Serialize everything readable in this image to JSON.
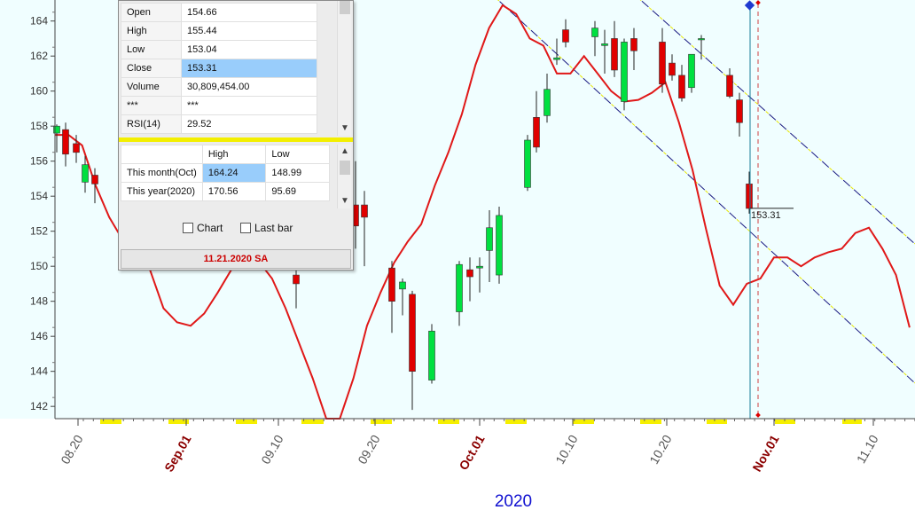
{
  "chart_data": {
    "type": "candlestick",
    "symbol_panel": {
      "ohlc_rows": [
        {
          "label": "Open",
          "value": "154.66"
        },
        {
          "label": "High",
          "value": "155.44"
        },
        {
          "label": "Low",
          "value": "153.04"
        },
        {
          "label": "Close",
          "value": "153.31"
        },
        {
          "label": "Volume",
          "value": "30,809,454.00"
        },
        {
          "label": "***",
          "value": "***"
        },
        {
          "label": "RSI(14)",
          "value": "29.52"
        }
      ],
      "range_header": {
        "high": "High",
        "low": "Low"
      },
      "range_rows": [
        {
          "label": "This month(Oct)",
          "high": "164.24",
          "low": "148.99"
        },
        {
          "label": "This year(2020)",
          "high": "170.56",
          "low": "95.69"
        }
      ],
      "chart_checkbox_label": "Chart",
      "lastbar_checkbox_label": "Last bar",
      "date_label": "11.21.2020 SA"
    },
    "last_price_label": "153.31",
    "y_axis": {
      "ticks": [
        142,
        144,
        146,
        148,
        150,
        152,
        154,
        156,
        158,
        160,
        162,
        164
      ],
      "range": [
        141.3,
        165.2
      ]
    },
    "x_axis": {
      "ticks": [
        {
          "label": "08.20",
          "month": false
        },
        {
          "label": "Sep.01",
          "month": true
        },
        {
          "label": "09.10",
          "month": false
        },
        {
          "label": "09.20",
          "month": false
        },
        {
          "label": "Oct.01",
          "month": true
        },
        {
          "label": "10.10",
          "month": false
        },
        {
          "label": "10.20",
          "month": false
        },
        {
          "label": "Nov.01",
          "month": true
        },
        {
          "label": "11.10",
          "month": false
        }
      ],
      "year_label": "2020"
    },
    "candles": [
      {
        "o": 157.6,
        "h": 158.1,
        "l": 156.5,
        "c": 158.0
      },
      {
        "o": 157.8,
        "h": 158.2,
        "l": 155.7,
        "c": 156.4
      },
      {
        "o": 157.0,
        "h": 157.5,
        "l": 155.9,
        "c": 156.5
      },
      {
        "o": 154.8,
        "h": 156.3,
        "l": 154.2,
        "c": 155.8
      },
      {
        "o": 155.2,
        "h": 155.6,
        "l": 153.6,
        "c": 154.7
      },
      {
        "o": 149.5,
        "h": 150.0,
        "l": 147.6,
        "c": 149.0
      },
      {
        "o": 153.5,
        "h": 156.0,
        "l": 151.0,
        "c": 152.3
      },
      {
        "o": 153.5,
        "h": 154.3,
        "l": 150.0,
        "c": 152.8
      },
      {
        "o": 149.9,
        "h": 150.3,
        "l": 146.2,
        "c": 148.0
      },
      {
        "o": 148.7,
        "h": 149.3,
        "l": 147.2,
        "c": 149.1
      },
      {
        "o": 148.4,
        "h": 148.6,
        "l": 141.8,
        "c": 144.0
      },
      {
        "o": 143.5,
        "h": 146.7,
        "l": 143.3,
        "c": 146.3
      },
      {
        "o": 147.4,
        "h": 150.3,
        "l": 146.6,
        "c": 150.1
      },
      {
        "o": 149.8,
        "h": 150.5,
        "l": 148.0,
        "c": 149.4
      },
      {
        "o": 149.9,
        "h": 150.5,
        "l": 148.5,
        "c": 150.0
      },
      {
        "o": 150.9,
        "h": 153.2,
        "l": 149.1,
        "c": 152.2
      },
      {
        "o": 149.5,
        "h": 153.4,
        "l": 149.0,
        "c": 152.9
      },
      {
        "o": 154.5,
        "h": 157.5,
        "l": 154.3,
        "c": 157.2
      },
      {
        "o": 158.5,
        "h": 160.0,
        "l": 156.5,
        "c": 156.8
      },
      {
        "o": 158.6,
        "h": 161.0,
        "l": 158.2,
        "c": 160.1
      },
      {
        "o": 161.8,
        "h": 163.0,
        "l": 161.5,
        "c": 161.9
      },
      {
        "o": 163.5,
        "h": 164.1,
        "l": 162.5,
        "c": 162.8
      },
      {
        "o": 163.1,
        "h": 164.0,
        "l": 162.0,
        "c": 163.6
      },
      {
        "o": 162.6,
        "h": 163.5,
        "l": 161.0,
        "c": 162.7
      },
      {
        "o": 163.0,
        "h": 164.0,
        "l": 160.8,
        "c": 161.2
      },
      {
        "o": 159.4,
        "h": 163.0,
        "l": 158.9,
        "c": 162.8
      },
      {
        "o": 163.0,
        "h": 163.6,
        "l": 161.2,
        "c": 162.3
      },
      {
        "o": 162.8,
        "h": 163.6,
        "l": 159.9,
        "c": 160.4
      },
      {
        "o": 161.6,
        "h": 162.1,
        "l": 160.6,
        "c": 160.9
      },
      {
        "o": 160.9,
        "h": 161.5,
        "l": 159.4,
        "c": 159.6
      },
      {
        "o": 160.2,
        "h": 162.1,
        "l": 159.9,
        "c": 162.1
      },
      {
        "o": 163.0,
        "h": 163.2,
        "l": 161.8,
        "c": 163.0
      },
      {
        "o": 160.9,
        "h": 161.3,
        "l": 159.6,
        "c": 159.7
      },
      {
        "o": 159.5,
        "h": 159.9,
        "l": 157.4,
        "c": 158.2
      },
      {
        "o": 154.7,
        "h": 155.4,
        "l": 153.0,
        "c": 153.3
      }
    ],
    "moving_average": [
      157.5,
      157.5,
      156.9,
      154.6,
      152.8,
      151.5,
      150.2,
      149.8,
      147.6,
      146.8,
      146.6,
      147.3,
      148.5,
      149.8,
      150.9,
      150.3,
      149.3,
      147.6,
      145.6,
      143.6,
      141.3,
      141.3,
      143.6,
      146.6,
      148.5,
      150.2,
      151.4,
      152.4,
      154.6,
      156.5,
      158.7,
      161.5,
      163.6,
      164.9,
      164.4,
      163.0,
      162.6,
      161.0,
      161.0,
      162.0,
      161.0,
      160.0,
      159.4,
      159.5,
      159.9,
      160.5,
      158.2,
      155.5,
      152.1,
      148.9,
      147.8,
      149.0,
      149.3,
      150.5,
      150.5,
      150.0,
      150.5,
      150.8,
      151.0,
      151.9,
      152.2,
      151.0,
      149.5,
      146.5
    ],
    "colors": {
      "up": "#00e040",
      "down": "#e00000",
      "ma": "#e01818",
      "plot_bg": "#f0feff",
      "channel": "#1a1a80"
    },
    "legend": null,
    "grid": false
  }
}
